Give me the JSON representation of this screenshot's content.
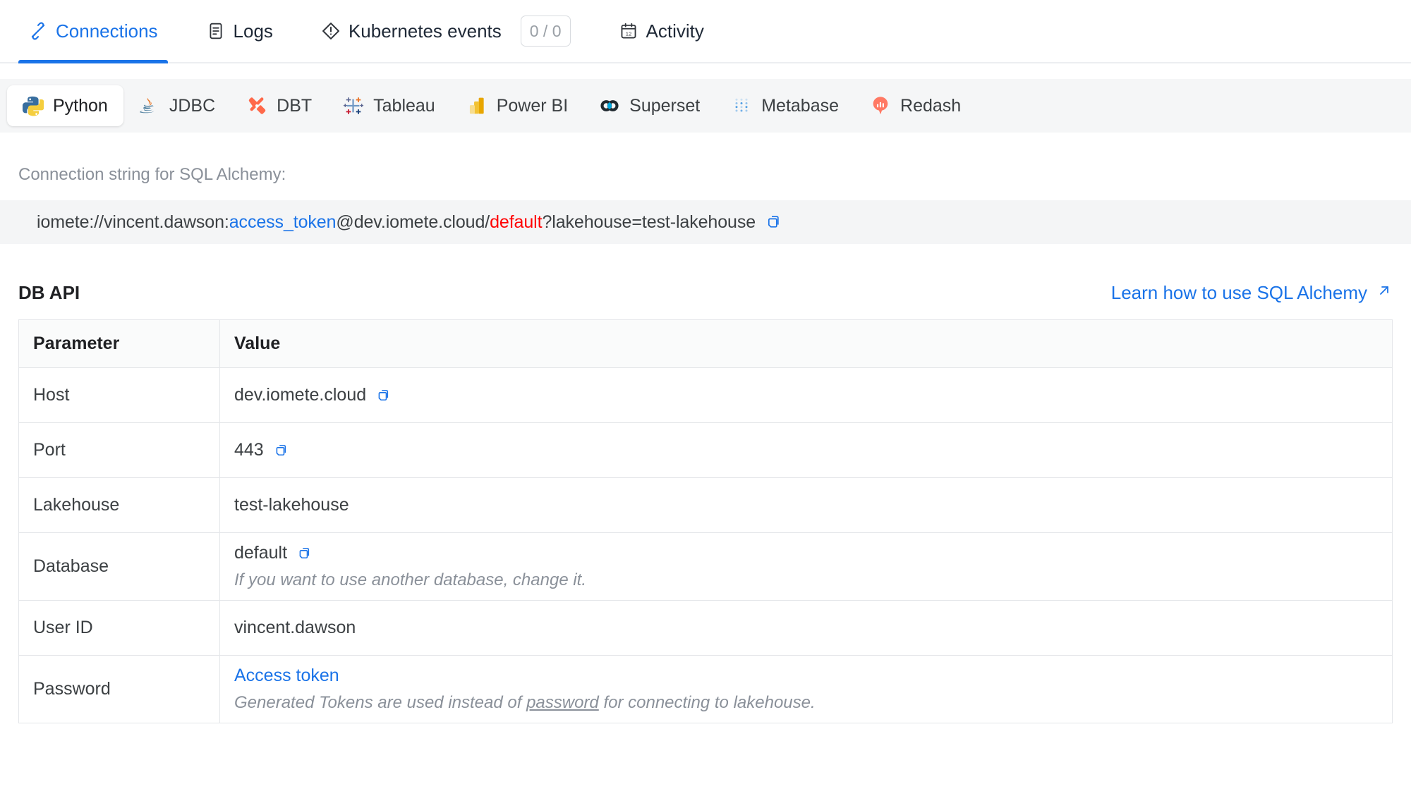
{
  "nav": {
    "tabs": [
      {
        "label": "Connections",
        "icon": "connections-icon",
        "active": true
      },
      {
        "label": "Logs",
        "icon": "logs-icon",
        "active": false
      },
      {
        "label": "Kubernetes events",
        "icon": "warning-diamond-icon",
        "active": false,
        "badge": "0 / 0"
      },
      {
        "label": "Activity",
        "icon": "calendar-icon",
        "active": false
      }
    ]
  },
  "tools": {
    "items": [
      {
        "label": "Python",
        "icon": "python-icon",
        "active": true
      },
      {
        "label": "JDBC",
        "icon": "java-icon",
        "active": false
      },
      {
        "label": "DBT",
        "icon": "dbt-icon",
        "active": false
      },
      {
        "label": "Tableau",
        "icon": "tableau-icon",
        "active": false
      },
      {
        "label": "Power BI",
        "icon": "powerbi-icon",
        "active": false
      },
      {
        "label": "Superset",
        "icon": "superset-icon",
        "active": false
      },
      {
        "label": "Metabase",
        "icon": "metabase-icon",
        "active": false
      },
      {
        "label": "Redash",
        "icon": "redash-icon",
        "active": false
      }
    ]
  },
  "connection": {
    "label": "Connection string for SQL Alchemy:",
    "string": {
      "prefix": "iomete://vincent.dawson:",
      "token": "access_token",
      "middle": "@dev.iomete.cloud/",
      "database": "default",
      "suffix": "?lakehouse=test-lakehouse"
    },
    "copy_icon": "copy-icon"
  },
  "db_api": {
    "title": "DB API",
    "learn_link": "Learn how to use SQL Alchemy",
    "learn_link_icon": "external-link-arrow-icon",
    "columns": [
      "Parameter",
      "Value"
    ],
    "rows": [
      {
        "parameter": "Host",
        "value": "dev.iomete.cloud",
        "copy": true,
        "note": "",
        "link": ""
      },
      {
        "parameter": "Port",
        "value": "443",
        "copy": true,
        "note": "",
        "link": ""
      },
      {
        "parameter": "Lakehouse",
        "value": "test-lakehouse",
        "copy": false,
        "note": "",
        "link": ""
      },
      {
        "parameter": "Database",
        "value": "default",
        "copy": true,
        "note": "If you want to use another database, change it.",
        "link": ""
      },
      {
        "parameter": "User ID",
        "value": "vincent.dawson",
        "copy": false,
        "note": "",
        "link": ""
      },
      {
        "parameter": "Password",
        "value": "",
        "copy": false,
        "note_pre": "Generated Tokens are used instead of ",
        "note_underline": "password",
        "note_post": " for connecting to lakehouse.",
        "link": "Access token"
      }
    ]
  },
  "colors": {
    "accent": "#1a73e8",
    "danger": "#ff0000",
    "strip_bg": "#f5f6f7",
    "code_bg": "#f4f5f6",
    "muted": "#8a9099"
  }
}
